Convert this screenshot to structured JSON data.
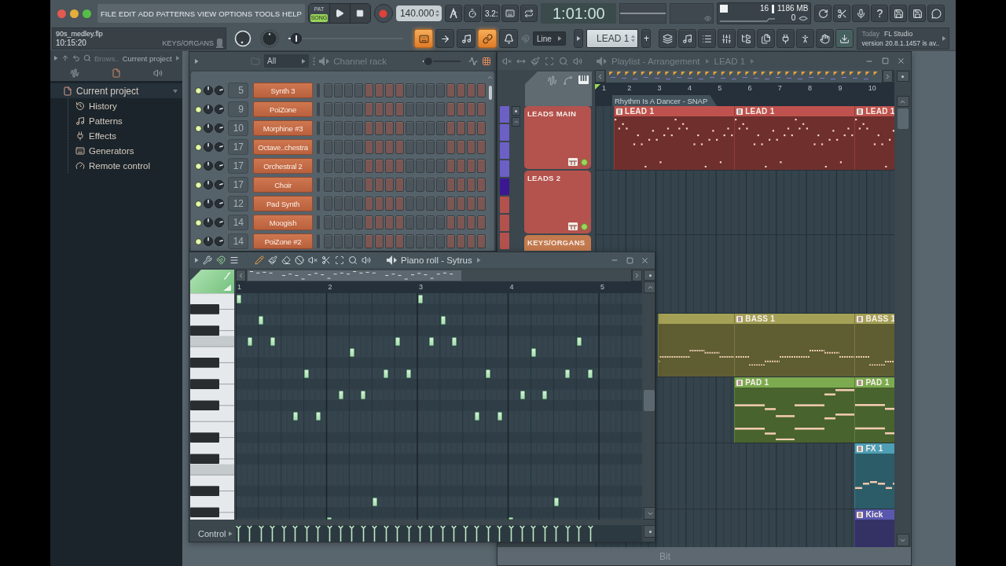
{
  "menu": [
    "FILE",
    "EDIT",
    "ADD",
    "PATTERNS",
    "VIEW",
    "OPTIONS",
    "TOOLS",
    "HELP"
  ],
  "transport": {
    "modes": [
      {
        "label": "PAT",
        "selected": false
      },
      {
        "label": "SONG",
        "selected": true
      }
    ],
    "tempo": "140.000",
    "countdown": "3.2:",
    "time": "1:01:00"
  },
  "monitor": {
    "cpu": "16",
    "memory": "1186 MB",
    "polyphony": "0"
  },
  "help": "?",
  "project": {
    "file": "90s_medley.flp",
    "elapsed": "10:15:20",
    "channel": "KEYS/ORGANS"
  },
  "song_position": {
    "level": 0.02
  },
  "tool_buttons": [
    {
      "on": true
    },
    {
      "on": false
    },
    {
      "on": false
    },
    {
      "on": true
    },
    {
      "on": false
    }
  ],
  "snap": "Line",
  "pattern": {
    "name": "LEAD 1",
    "add": "+"
  },
  "hint": {
    "day": "Today",
    "title": "FL Studio",
    "message": "version 20.8.1.1457 is av.."
  },
  "browser": {
    "crumb": "Brows..",
    "location": "Current project",
    "tree": [
      {
        "label": "Current project",
        "selected": true,
        "expanded": true,
        "children": [
          {
            "label": "History",
            "selected": false
          },
          {
            "label": "Patterns",
            "selected": false
          },
          {
            "label": "Effects",
            "selected": false
          },
          {
            "label": "Generators",
            "selected": false
          },
          {
            "label": "Remote control",
            "selected": false
          }
        ]
      }
    ]
  },
  "channel_rack": {
    "filter": "All",
    "title": "Channel rack",
    "swing": {
      "level": 0.04
    },
    "channels": [
      {
        "name": "Synth 3",
        "track": "5",
        "enabled": true
      },
      {
        "name": "PoiZone",
        "track": "9",
        "enabled": true
      },
      {
        "name": "Morphine #3",
        "track": "10",
        "enabled": true
      },
      {
        "name": "Octave..chestra",
        "track": "17",
        "enabled": true
      },
      {
        "name": "Orchestral 2",
        "track": "17",
        "enabled": true
      },
      {
        "name": "Choir",
        "track": "17",
        "enabled": true
      },
      {
        "name": "Pad Synth",
        "track": "12",
        "enabled": true
      },
      {
        "name": "Moogish",
        "track": "14",
        "enabled": true
      },
      {
        "name": "PoiZone #2",
        "track": "14",
        "enabled": true
      }
    ]
  },
  "playlist": {
    "title": "Playlist - Arrangement",
    "pattern": "LEAD 1",
    "ruler": [
      "1",
      "2",
      "3",
      "4",
      "5",
      "6",
      "7",
      "8",
      "9",
      "10"
    ],
    "marker": "Rhythm Is A Dancer - SNAP",
    "patterns": [
      {
        "color": "#6c60c6"
      },
      {
        "color": "#6c60c6"
      },
      {
        "color": "#6c60c6"
      },
      {
        "color": "#6c60c6"
      },
      {
        "color": "#3c1792"
      },
      {
        "color": "#b3514d"
      },
      {
        "color": "#b3514d"
      },
      {
        "color": "#b3514d"
      }
    ],
    "tracks": [
      {
        "name": "LEADS MAIN",
        "color": "#b4524e",
        "clips": [
          {
            "label": "LEAD 1",
            "color": "#bf524e",
            "kind": "melody"
          },
          {
            "label": "LEAD 1",
            "color": "#bf524e",
            "kind": "melody"
          },
          {
            "label": "LEAD 1",
            "color": "#bf524e",
            "kind": "melody"
          }
        ]
      },
      {
        "name": "LEADS 2",
        "color": "#b4524e"
      },
      {
        "name": "KEYS/ORGANS",
        "color": "#c47a4e"
      },
      {
        "clips": [
          {
            "color": "#a4a156",
            "kind": "bass"
          },
          {
            "label": "BASS 1",
            "color": "#a4a156",
            "kind": "bass"
          },
          {
            "label": "BASS 1",
            "color": "#a4a156",
            "kind": "bass"
          }
        ]
      },
      {
        "clips": [
          {
            "label": "PAD 1",
            "color": "#7cab4f",
            "kind": "pad"
          },
          {
            "label": "PAD 1",
            "color": "#7cab4f",
            "kind": "pad"
          }
        ]
      },
      {
        "clips": [
          {
            "label": "FX 1",
            "color": "#4e9fb5",
            "kind": "fx"
          }
        ]
      },
      {
        "clips": [
          {
            "label": "Kick",
            "color": "#5a57ae",
            "kind": "drum"
          }
        ]
      }
    ],
    "hint": "Bit"
  },
  "piano_roll": {
    "title": "Piano roll - Sytrus",
    "ruler": [
      "1",
      "2",
      "3",
      "4",
      "5"
    ],
    "control": "Control"
  }
}
